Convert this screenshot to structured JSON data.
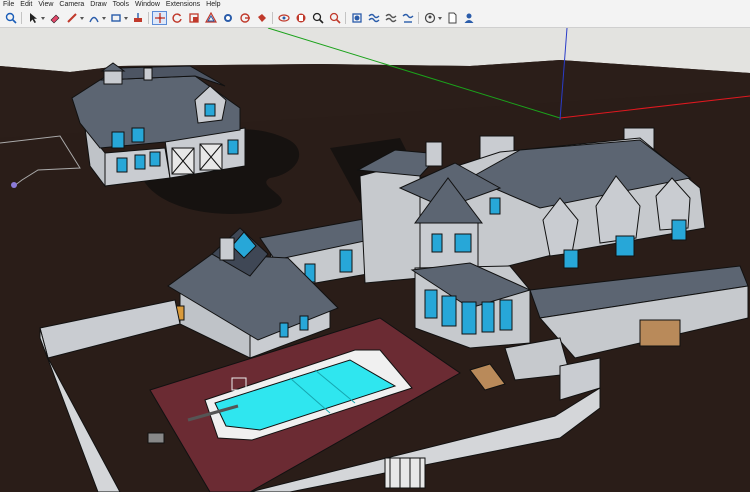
{
  "menubar": {
    "items": [
      "File",
      "Edit",
      "View",
      "Camera",
      "Draw",
      "Tools",
      "Window",
      "Extensions",
      "Help"
    ]
  },
  "toolbar": {
    "buttons": [
      {
        "icon": "search-icon"
      },
      {
        "icon": "select-arrow-icon",
        "caret": true
      },
      {
        "icon": "eraser-icon"
      },
      {
        "icon": "pencil-line-icon",
        "caret": true
      },
      {
        "icon": "arc-icon",
        "caret": true
      },
      {
        "icon": "rectangle-icon",
        "caret": true
      },
      {
        "icon": "push-pull-icon"
      },
      {
        "icon": "move-icon",
        "active": true
      },
      {
        "icon": "rotate-icon"
      },
      {
        "icon": "scale-icon"
      },
      {
        "icon": "offset-icon"
      },
      {
        "icon": "follow-me-icon"
      },
      {
        "icon": "tape-measure-icon"
      },
      {
        "icon": "paint-bucket-icon"
      },
      {
        "icon": "orbit-icon"
      },
      {
        "icon": "pan-icon"
      },
      {
        "icon": "zoom-icon"
      },
      {
        "icon": "zoom-extents-icon"
      },
      {
        "icon": "section-plane-icon"
      },
      {
        "icon": "solid-tools-icon"
      },
      {
        "icon": "sandbox-icon"
      },
      {
        "icon": "position-camera-icon"
      },
      {
        "icon": "walk-icon",
        "caret": true
      },
      {
        "icon": "document-icon"
      },
      {
        "icon": "user-account-icon"
      }
    ]
  },
  "scene": {
    "ground_color": "#2a1d18",
    "sky_color": "#e3e3e0",
    "wall_color": "#c6c9cd",
    "roof_color": "#5c6572",
    "glass_color": "#27a7d8",
    "pool_water_color": "#2fe6ef",
    "terrace_color": "#6b2b33",
    "axis_colors": {
      "red": "#e0181f",
      "green": "#1ba21b",
      "blue": "#2a3cc8"
    }
  }
}
